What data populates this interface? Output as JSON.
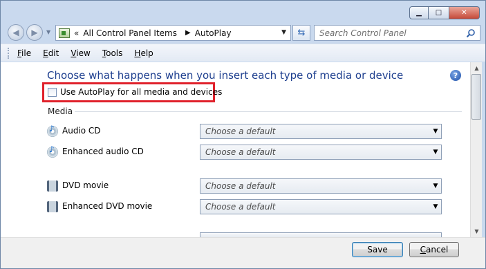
{
  "window": {
    "caption_buttons": {
      "minimize": "minimize-icon",
      "maximize": "maximize-icon",
      "close": "close-icon"
    }
  },
  "nav": {
    "address_prefix": "«",
    "breadcrumbs": [
      "All Control Panel Items",
      "AutoPlay"
    ],
    "breadcrumb_separator": "▶",
    "search_placeholder": "Search Control Panel"
  },
  "menu": {
    "items": [
      {
        "label": "File",
        "accel": "F",
        "rest": "ile"
      },
      {
        "label": "Edit",
        "accel": "E",
        "rest": "dit"
      },
      {
        "label": "View",
        "accel": "V",
        "rest": "iew"
      },
      {
        "label": "Tools",
        "accel": "T",
        "rest": "ools"
      },
      {
        "label": "Help",
        "accel": "H",
        "rest": "elp"
      }
    ]
  },
  "main": {
    "heading": "Choose what happens when you insert each type of media or device",
    "autoplay_checkbox_label": "Use AutoPlay for all media and devices",
    "autoplay_checked": false,
    "section_media": "Media",
    "media_rows": [
      {
        "label": "Audio CD",
        "value": "Choose a default",
        "icon": "audio-cd-icon"
      },
      {
        "label": "Enhanced audio CD",
        "value": "Choose a default",
        "icon": "enhanced-audio-cd-icon"
      },
      {
        "label": "DVD movie",
        "value": "Choose a default",
        "icon": "dvd-movie-icon"
      },
      {
        "label": "Enhanced DVD movie",
        "value": "Choose a default",
        "icon": "enhanced-dvd-movie-icon"
      }
    ],
    "highlight_color": "#e0212b"
  },
  "footer": {
    "save_label": "Save",
    "cancel_label": "Cancel",
    "cancel_accel": "C",
    "cancel_rest": "ancel"
  }
}
